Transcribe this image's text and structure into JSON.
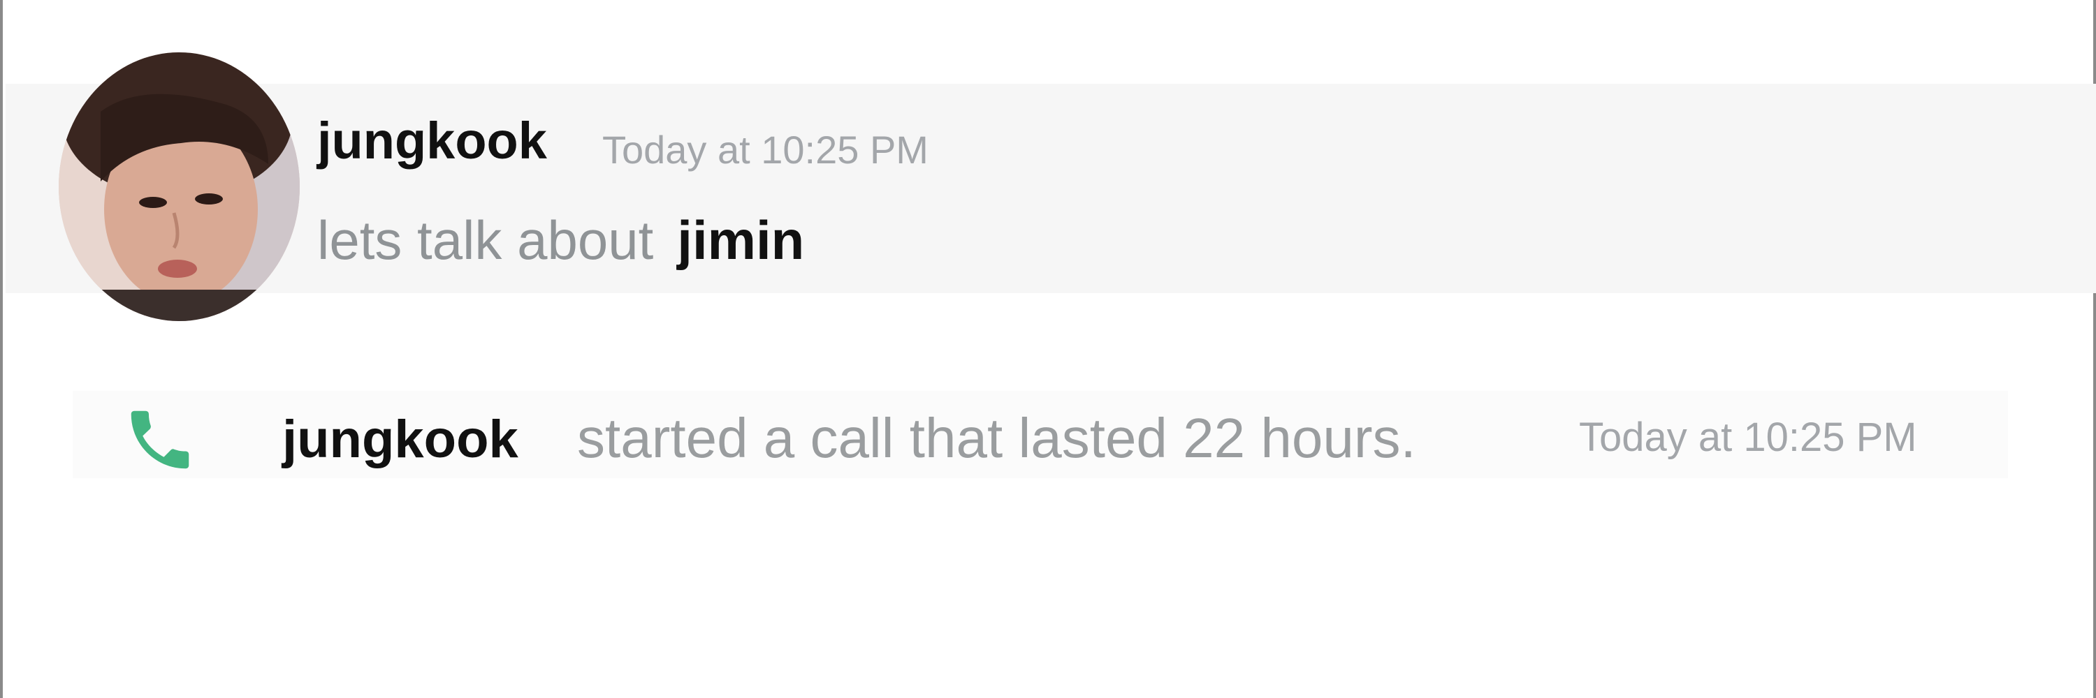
{
  "message": {
    "username": "jungkook",
    "timestamp": "Today at 10:25 PM",
    "text": "lets talk about",
    "mention": "jimin"
  },
  "call_event": {
    "icon": "phone-icon",
    "username": "jungkook",
    "text": "started a call that lasted 22 hours.",
    "timestamp": "Today at 10:25 PM",
    "icon_color": "#43b581"
  }
}
